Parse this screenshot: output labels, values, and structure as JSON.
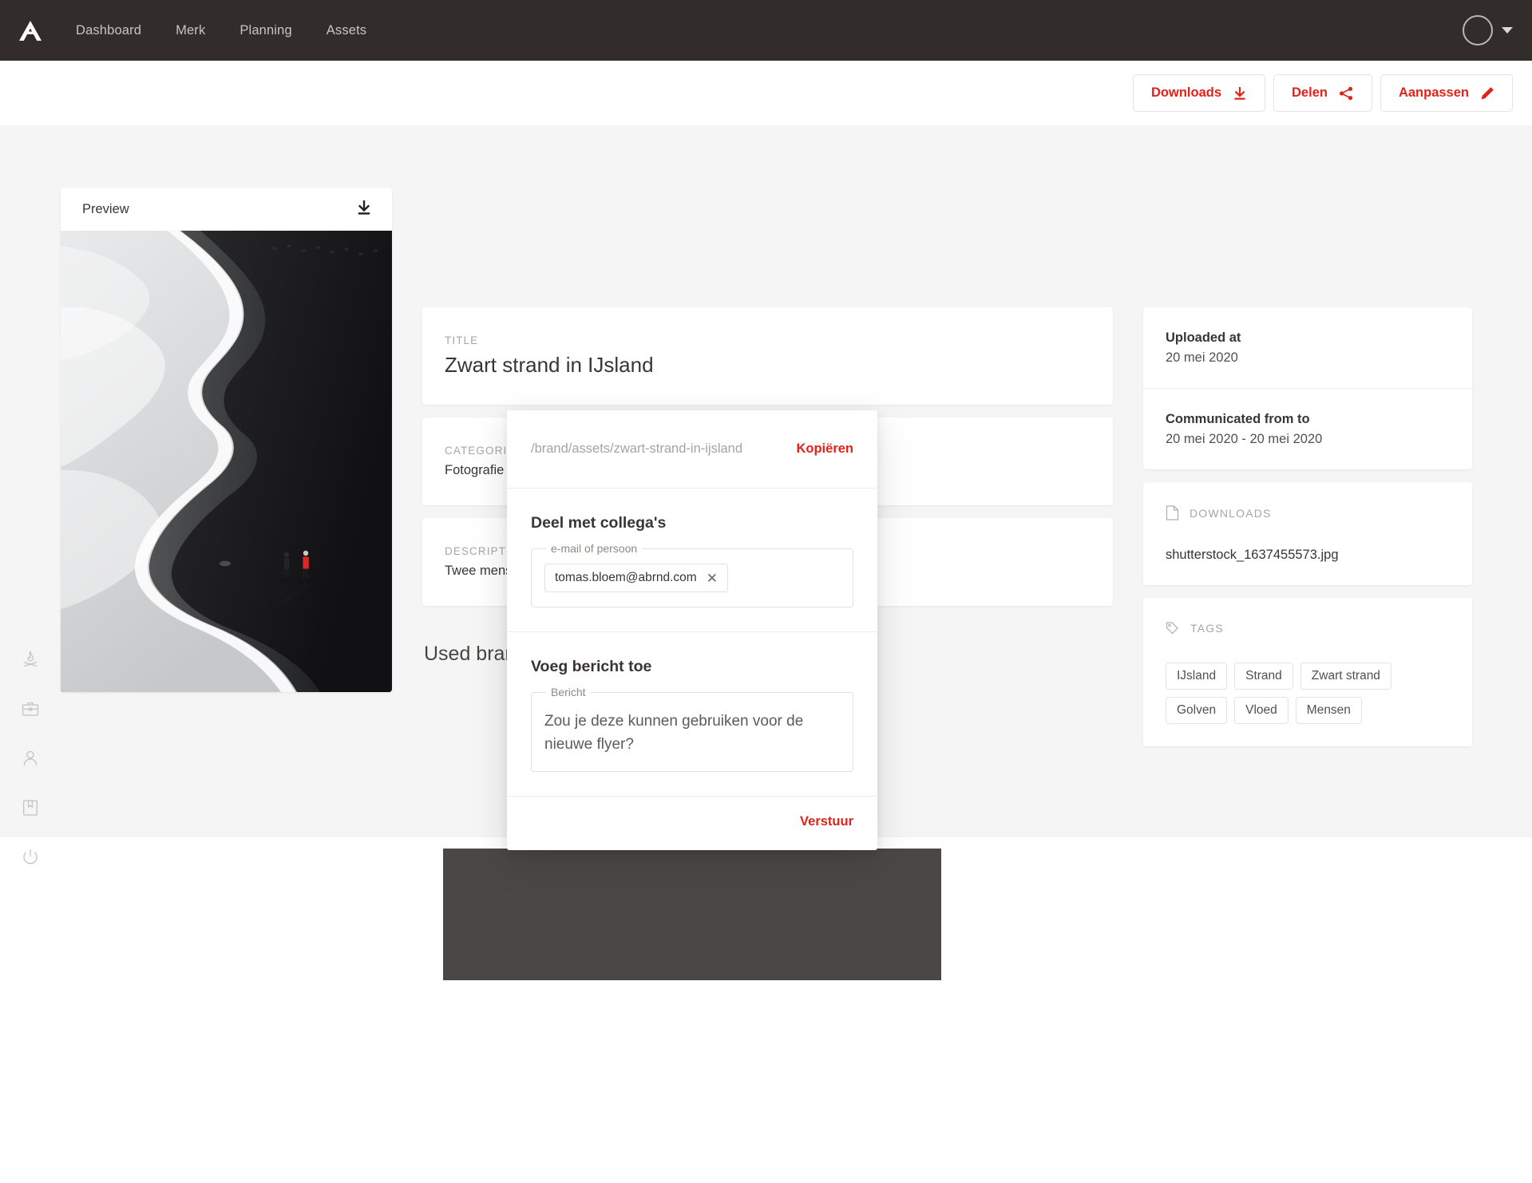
{
  "nav": {
    "logo_icon": "abrnd-logo-icon",
    "links": [
      {
        "label": "Dashboard"
      },
      {
        "label": "Merk"
      },
      {
        "label": "Planning"
      },
      {
        "label": "Assets"
      }
    ],
    "avatar_icon": "avatar-icon",
    "caret_icon": "chevron-down-icon"
  },
  "actionbar": {
    "downloads": {
      "label": "Downloads",
      "icon": "download-icon"
    },
    "delen": {
      "label": "Delen",
      "icon": "share-icon"
    },
    "aanpassen": {
      "label": "Aanpassen",
      "icon": "pencil-icon"
    }
  },
  "rail": {
    "items": [
      {
        "icon": "campfire-icon"
      },
      {
        "icon": "briefcase-icon"
      },
      {
        "icon": "person-icon"
      },
      {
        "icon": "book-icon"
      },
      {
        "icon": "power-icon"
      }
    ]
  },
  "preview": {
    "title": "Preview",
    "download_icon": "download-icon",
    "image_alt": "Zwart strand in IJsland"
  },
  "details": {
    "title": {
      "label": "TITLE",
      "value": "Zwart strand in IJsland"
    },
    "categorie": {
      "label": "CATEGORIE",
      "value": "Fotografie"
    },
    "description": {
      "label": "DESCRIPTION",
      "value": "Twee mensen"
    },
    "used_brand_heading": "Used brand"
  },
  "sidebar": {
    "uploaded": {
      "label": "Uploaded at",
      "value": "20 mei 2020"
    },
    "communicated": {
      "label": "Communicated from to",
      "value": "20 mei 2020 - 20 mei 2020"
    },
    "downloads": {
      "heading": "DOWNLOADS",
      "icon": "file-icon",
      "files": [
        {
          "name": "shutterstock_1637455573.jpg"
        }
      ]
    },
    "tags": {
      "heading": "TAGS",
      "icon": "tag-icon",
      "items": [
        {
          "label": "IJsland"
        },
        {
          "label": "Strand"
        },
        {
          "label": "Zwart strand"
        },
        {
          "label": "Golven"
        },
        {
          "label": "Vloed"
        },
        {
          "label": "Mensen"
        }
      ]
    }
  },
  "modal": {
    "url": "/brand/assets/zwart-strand-in-ijsland",
    "copy_label": "Kopiëren",
    "share": {
      "heading": "Deel met collega's",
      "field_legend": "e-mail of persoon",
      "chips": [
        {
          "email": "tomas.bloem@abrnd.com",
          "remove_icon": "close-icon"
        }
      ]
    },
    "message": {
      "heading": "Voeg bericht toe",
      "field_legend": "Bericht",
      "value": "Zou je deze kunnen gebruiken voor de nieuwe flyer?"
    },
    "submit_label": "Verstuur"
  },
  "colors": {
    "nav_bg": "#322c2a",
    "accent_red": "#e2231a",
    "page_bg": "#f6f5f5",
    "card_bg": "#ffffff",
    "swatch": "#4b4746"
  }
}
